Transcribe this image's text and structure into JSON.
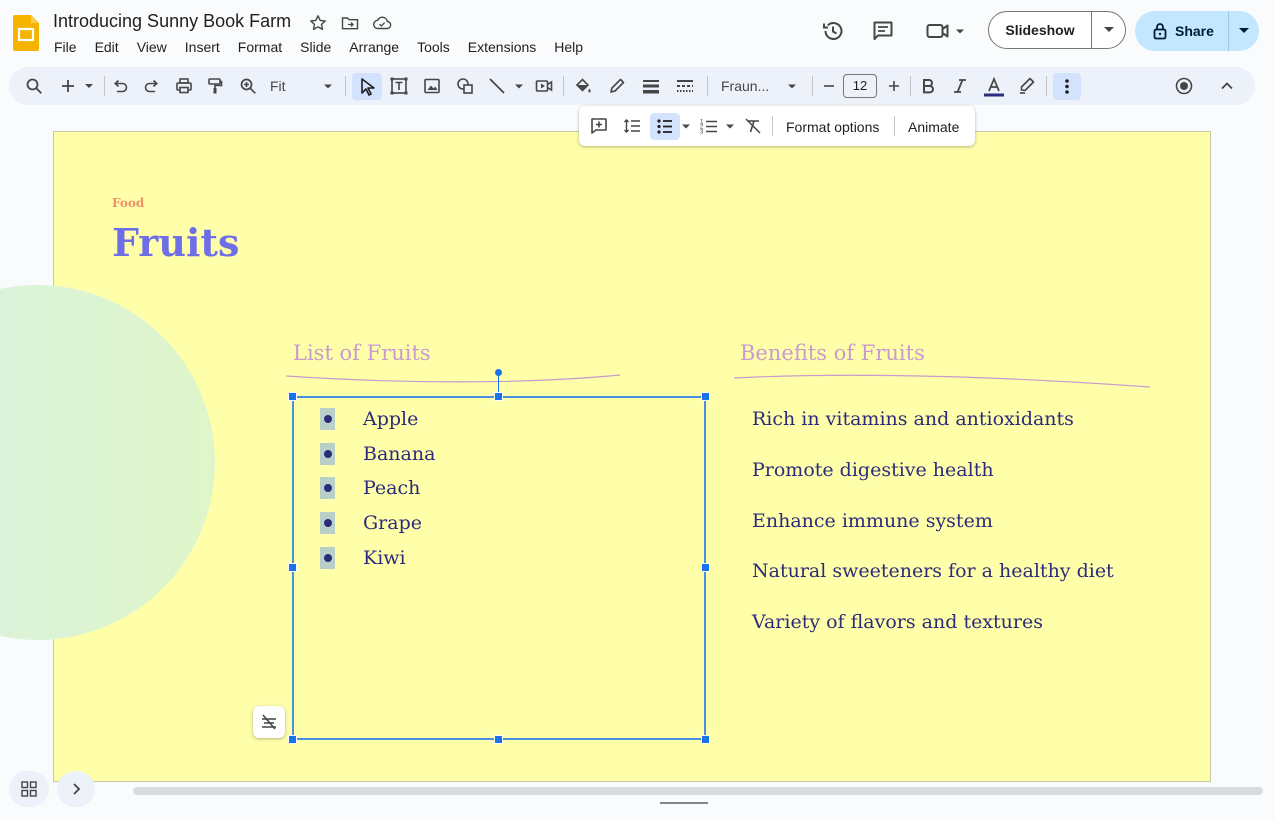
{
  "app": {
    "doc_title": "Introducing Sunny Book Farm",
    "menu": [
      "File",
      "Edit",
      "View",
      "Insert",
      "Format",
      "Slide",
      "Arrange",
      "Tools",
      "Extensions",
      "Help"
    ],
    "slideshow_label": "Slideshow",
    "share_label": "Share",
    "accent_color": "#1a73e8",
    "share_bg": "#c2e7ff"
  },
  "toolbar": {
    "zoom_value": "Fit",
    "font_name": "Fraun...",
    "font_size": "12"
  },
  "context_toolbar": {
    "format_options_label": "Format options",
    "animate_label": "Animate"
  },
  "slide": {
    "background": "#ffffaa",
    "kicker": "Food",
    "title": "Fruits",
    "list_heading": "List of Fruits",
    "benefits_heading": "Benefits of Fruits",
    "fruits": [
      "Apple",
      "Banana",
      "Peach",
      "Grape",
      "Kiwi"
    ],
    "benefits": [
      "Rich in vitamins and antioxidants",
      "Promote digestive health",
      "Enhance immune system",
      "Natural sweeteners for a healthy diet",
      "Variety of flavors and textures"
    ],
    "title_color": "#6e6ee6",
    "kicker_color": "#f28f6b",
    "heading_color": "#c79ad0",
    "body_color": "#2b2b7c"
  }
}
